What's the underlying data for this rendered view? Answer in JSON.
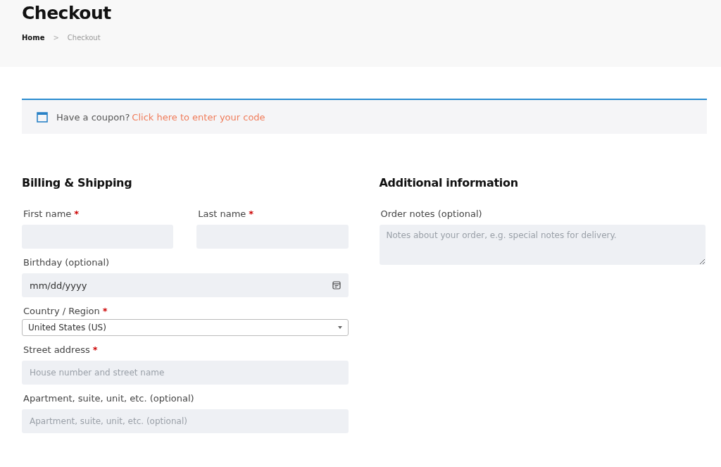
{
  "page_title": "Checkout",
  "breadcrumb": [
    {
      "label": "Home",
      "current": false
    },
    {
      "label": ">",
      "kind": "separator"
    },
    {
      "label": "Checkout",
      "current": true
    }
  ],
  "coupon": {
    "text": "Have a coupon?",
    "link": "Click here to enter your code"
  },
  "billing": {
    "heading": "Billing & Shipping",
    "rows": [
      [
        {
          "label": "First name",
          "mark": "*",
          "kind": "text"
        },
        {
          "label": "Last name",
          "mark": "*",
          "kind": "text"
        }
      ],
      [
        {
          "label": "Birthday (optional)",
          "kind": "date",
          "value": "mm/dd/yyyy"
        }
      ],
      [
        {
          "label": "Country / Region",
          "mark": "*",
          "kind": "select",
          "value": "United States (US)"
        }
      ],
      [
        {
          "label": "Street address",
          "mark": "*",
          "kind": "text",
          "placeholder": "House number and street name"
        }
      ],
      [
        {
          "label": "Apartment, suite, unit, etc. (optional)",
          "kind": "text",
          "placeholder": "Apartment, suite, unit, etc. (optional)"
        }
      ]
    ]
  },
  "additional": {
    "heading": "Additional information",
    "label": "Order notes (optional)",
    "placeholder": "Notes about your order, e.g. special notes for delivery."
  }
}
